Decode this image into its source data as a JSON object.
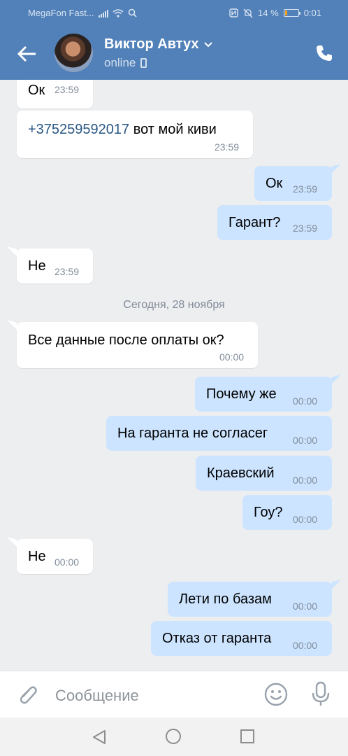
{
  "status_bar": {
    "carrier": "MegaFon Fast...",
    "battery_percent": "14 %",
    "time": "0:01",
    "battery_level": 0.14,
    "icons": [
      "signal-icon",
      "wifi-icon",
      "search-icon",
      "nfc-icon",
      "mute-icon",
      "battery-icon"
    ]
  },
  "header": {
    "contact_name": "Виктор Автух",
    "status": "online",
    "icons": [
      "back-arrow-icon",
      "chevron-down-icon",
      "mobile-device-icon",
      "phone-call-icon"
    ]
  },
  "messages": [
    {
      "dir": "in",
      "text": "Ок",
      "time": "23:59"
    },
    {
      "dir": "in",
      "link": "+375259592017",
      "text": " вот мой киви",
      "time": "23:59"
    },
    {
      "dir": "out",
      "text": "Ок",
      "time": "23:59"
    },
    {
      "dir": "out",
      "text": "Гарант?",
      "time": "23:59"
    },
    {
      "dir": "in",
      "text": "Не",
      "time": "23:59"
    },
    {
      "dir": "in",
      "text": "Все данные после оплаты ок?",
      "time": "00:00"
    },
    {
      "dir": "out",
      "text": "Почему же",
      "time": "00:00"
    },
    {
      "dir": "out",
      "text": "На гаранта не согласег",
      "time": "00:00"
    },
    {
      "dir": "out",
      "text": "Краевский",
      "time": "00:00"
    },
    {
      "dir": "out",
      "text": "Гоу?",
      "time": "00:00"
    },
    {
      "dir": "in",
      "text": "Не",
      "time": "00:00"
    },
    {
      "dir": "out",
      "text": "Лети по базам",
      "time": "00:00"
    },
    {
      "dir": "out",
      "text": "Отказ от гаранта",
      "time": "00:00"
    }
  ],
  "date_separator": "Сегодня, 28 ноября",
  "input": {
    "placeholder": "Сообщение",
    "icons": [
      "attachment-icon",
      "emoji-icon",
      "microphone-icon"
    ]
  },
  "colors": {
    "header": "#5181b8",
    "incoming": "#ffffff",
    "outgoing": "#cce4ff",
    "link": "#2a5885",
    "background": "#edeef0"
  }
}
